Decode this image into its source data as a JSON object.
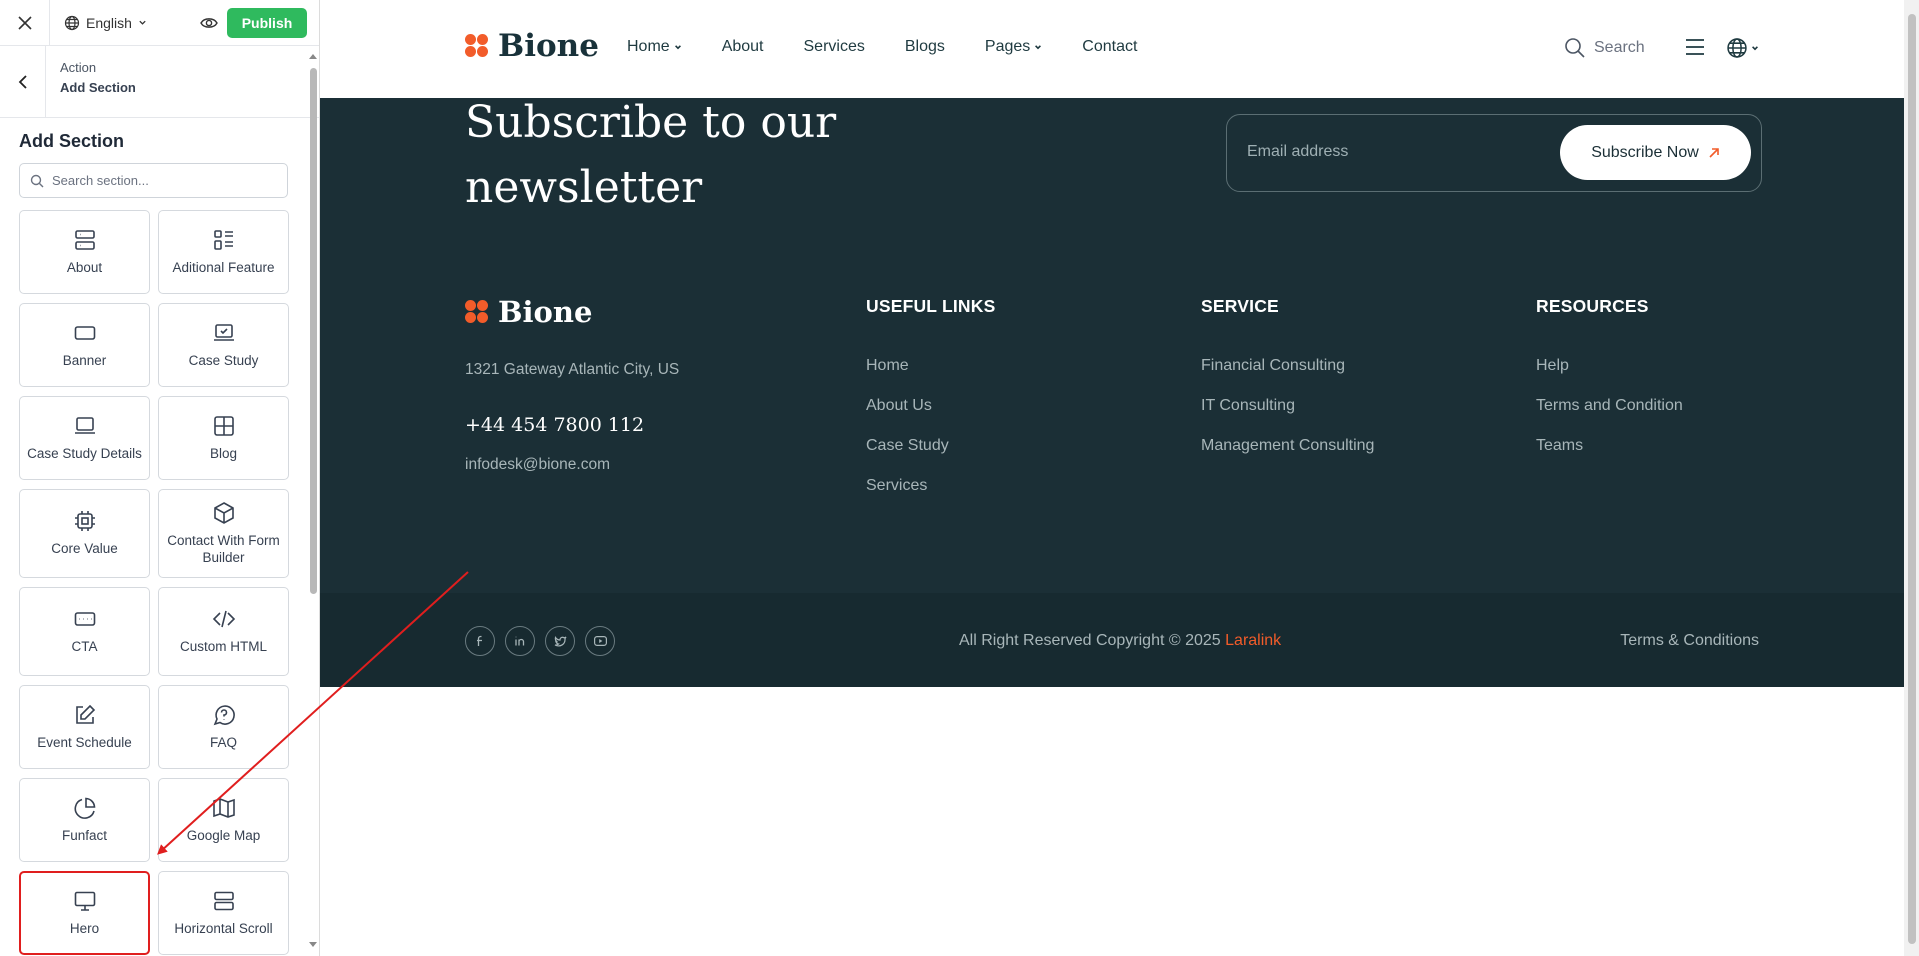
{
  "editor": {
    "language": "English",
    "publish_label": "Publish",
    "breadcrumb": {
      "parent": "Action",
      "current": "Add Section"
    },
    "section_title": "Add Section",
    "search_placeholder": "Search section...",
    "tiles": [
      {
        "label": "About",
        "icon": "server-icon"
      },
      {
        "label": "Aditional Feature",
        "icon": "list-icon"
      },
      {
        "label": "Banner",
        "icon": "rectangle-icon"
      },
      {
        "label": "Case Study",
        "icon": "laptop-check-icon"
      },
      {
        "label": "Case Study Details",
        "icon": "laptop-icon"
      },
      {
        "label": "Blog",
        "icon": "grid-icon"
      },
      {
        "label": "Core Value",
        "icon": "chip-icon"
      },
      {
        "label": "Contact With Form Builder",
        "icon": "box-icon"
      },
      {
        "label": "CTA",
        "icon": "keyboard-icon"
      },
      {
        "label": "Custom HTML",
        "icon": "code-icon"
      },
      {
        "label": "Event Schedule",
        "icon": "edit-icon"
      },
      {
        "label": "FAQ",
        "icon": "question-icon"
      },
      {
        "label": "Funfact",
        "icon": "pie-chart-icon"
      },
      {
        "label": "Google Map",
        "icon": "map-icon"
      },
      {
        "label": "Hero",
        "icon": "monitor-icon"
      },
      {
        "label": "Horizontal Scroll",
        "icon": "rows-icon"
      }
    ]
  },
  "site": {
    "brand": "Bione",
    "accent_color": "#f25c2a",
    "nav": [
      "Home",
      "About",
      "Services",
      "Blogs",
      "Pages",
      "Contact"
    ],
    "search_label": "Search",
    "newsletter": {
      "title_line1": "Subscribe to our",
      "title_line2": "newsletter",
      "email_placeholder": "Email address",
      "button_label": "Subscribe Now"
    },
    "contact": {
      "address": "1321 Gateway Atlantic City, US",
      "phone": "+44 454 7800 112",
      "email": "infodesk@bione.com"
    },
    "columns": {
      "useful": {
        "title": "USEFUL LINKS",
        "links": [
          "Home",
          "About Us",
          "Case Study",
          "Services"
        ]
      },
      "service": {
        "title": "SERVICE",
        "links": [
          "Financial Consulting",
          "IT Consulting",
          "Management Consulting"
        ]
      },
      "resources": {
        "title": "RESOURCES",
        "links": [
          "Help",
          "Terms and Condition",
          "Teams"
        ]
      }
    },
    "copyright_prefix": "All Right Reserved Copyright © 2025 ",
    "copyright_brand": "Laralink",
    "terms": "Terms & Conditions"
  }
}
